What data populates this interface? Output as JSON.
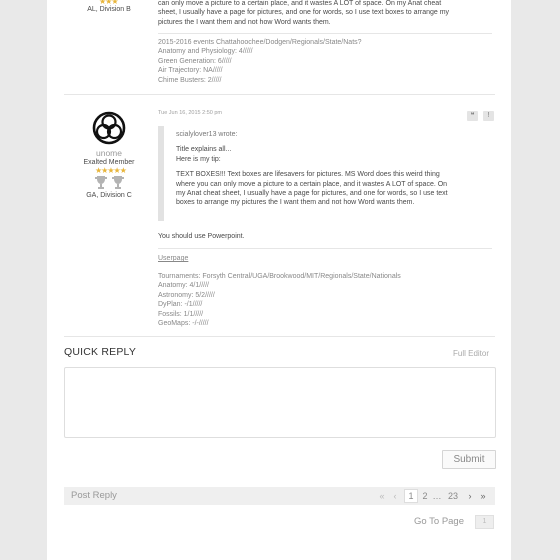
{
  "post1": {
    "author_location": "AL, Division B",
    "text_lines": [
      "can only move a picture to a certain place, and it wastes A LOT of space. On my Anat cheat",
      "sheet, I usually have a page for pictures, and one for words, so I use text boxes to arrange my",
      "pictures the I want them and not how Word wants them."
    ],
    "signature": [
      "2015-2016 events Chattahoochee/Dodgen/Regionals/State/Nats?",
      "Anatomy and Physiology: 4/////",
      "Green Generation: 6/////",
      "Air Trajectory: NA/////",
      "Chime Busters: 2/////"
    ]
  },
  "post2": {
    "username": "unome",
    "rank": "Exalted Member",
    "location": "GA, Division C",
    "timestamp": "Tue Jun 16, 2015 2:50 pm",
    "quote_button": "❝",
    "report_button": "!",
    "quote": {
      "header": "scialylover13 wrote:",
      "line1": "Title explains all...",
      "line2": "Here is my tip:",
      "body": [
        "TEXT BOXES!!! Text boxes are lifesavers for pictures. MS Word does this weird thing",
        "where you can only move a picture to a certain place, and it wastes A LOT of space. On",
        "my Anat cheat sheet, I usually have a page for pictures, and one for words, so I use text",
        "boxes to arrange my pictures the I want them and not how Word wants them."
      ]
    },
    "reply_text": "You should use Powerpoint.",
    "signature_link": "Userpage",
    "signature": [
      "Tournaments: Forsyth Central/UGA/Brookwood/MIT/Regionals/State/Nationals",
      "Anatomy: 4/1/////",
      "Astronomy: 5/2/////",
      "DyPlan: -/1/////",
      "Fossils: 1/1/////",
      "GeoMaps: -/-/////"
    ]
  },
  "quick_reply": {
    "title": "QUICK REPLY",
    "full_editor": "Full Editor",
    "submit": "Submit"
  },
  "pagination": {
    "post_reply": "Post Reply",
    "first": "«",
    "prev": "‹",
    "pages": [
      "1",
      "2"
    ],
    "ellipsis": "…",
    "last_page": "23",
    "next": "›",
    "last": "»",
    "goto_label": "Go To Page",
    "goto_value": "1"
  }
}
